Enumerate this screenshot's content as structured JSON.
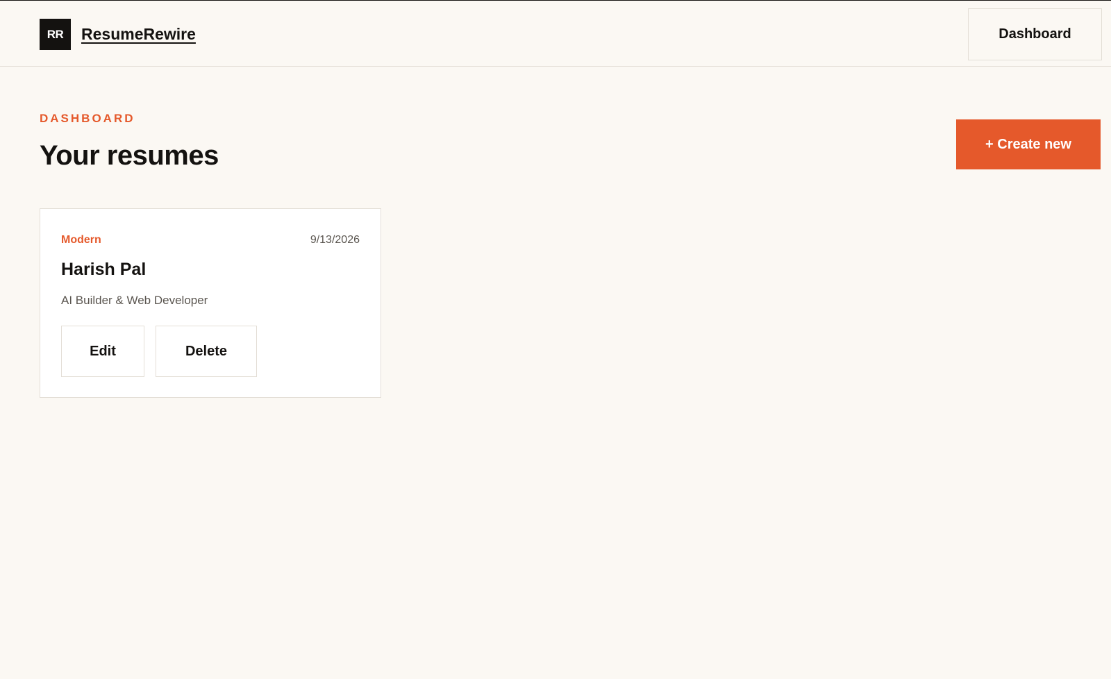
{
  "header": {
    "logo_initials": "RR",
    "brand_name": "ResumeRewire",
    "nav_dashboard_label": "Dashboard"
  },
  "main": {
    "eyebrow": "DASHBOARD",
    "title": "Your resumes",
    "create_label": "+ Create new"
  },
  "resumes": [
    {
      "template": "Modern",
      "date": "9/13/2026",
      "name": "Harish Pal",
      "role": "AI Builder & Web Developer",
      "edit_label": "Edit",
      "delete_label": "Delete"
    }
  ],
  "colors": {
    "background": "#fbf8f3",
    "accent": "#e5592b",
    "ink": "#141210",
    "border": "#e3ded6",
    "muted_text": "#5a554f"
  }
}
